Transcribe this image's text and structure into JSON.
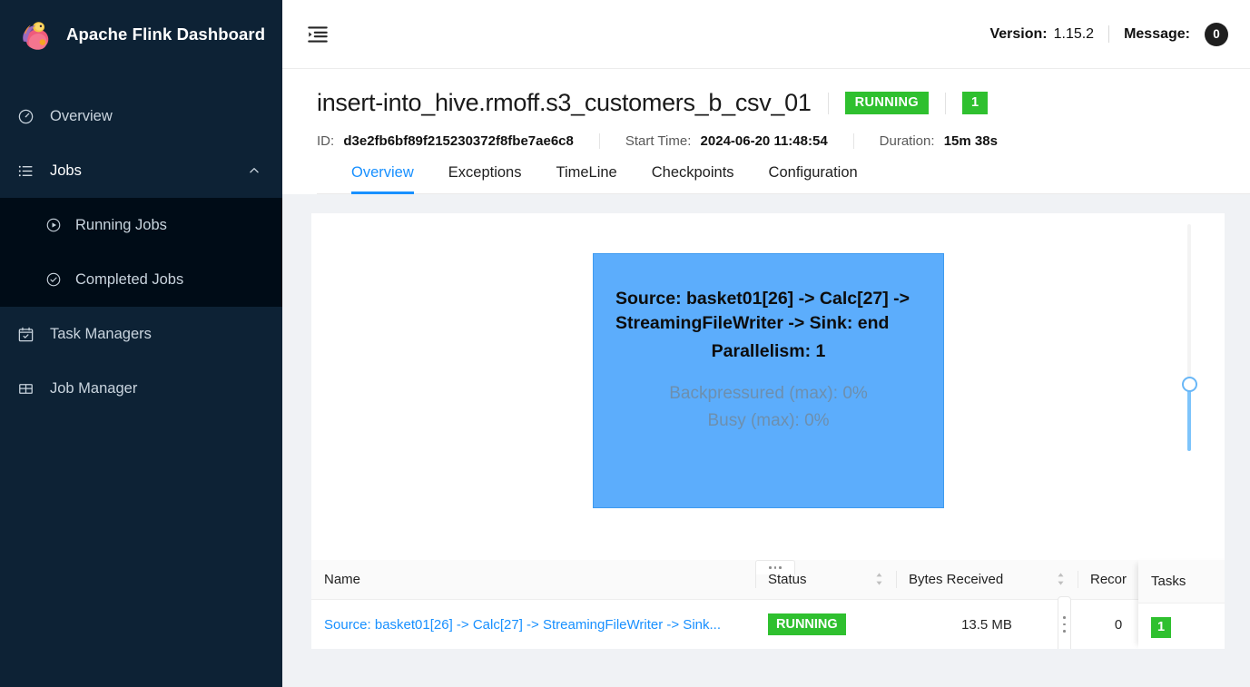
{
  "brand": {
    "title": "Apache Flink Dashboard",
    "logo_icon": "flink-squirrel-logo"
  },
  "sidebar": {
    "items": [
      {
        "label": "Overview",
        "icon": "dashboard-icon"
      },
      {
        "label": "Jobs",
        "icon": "list-icon",
        "expand_icon": "chevron-up-icon"
      },
      {
        "label": "Task Managers",
        "icon": "calendar-check-icon"
      },
      {
        "label": "Job Manager",
        "icon": "grid-icon"
      }
    ],
    "jobs_submenu": [
      {
        "label": "Running Jobs",
        "icon": "play-circle-icon"
      },
      {
        "label": "Completed Jobs",
        "icon": "check-circle-icon"
      }
    ]
  },
  "topbar": {
    "fold_icon": "menu-fold-icon",
    "version_label": "Version:",
    "version_value": "1.15.2",
    "message_label": "Message:",
    "message_count": "0"
  },
  "job": {
    "name": "insert-into_hive.rmoff.s3_customers_b_csv_01",
    "status": "RUNNING",
    "task_count": "1",
    "id_label": "ID:",
    "id_value": "d3e2fb6bf89f215230372f8fbe7ae6c8",
    "start_label": "Start Time:",
    "start_value": "2024-06-20 11:48:54",
    "duration_label": "Duration:",
    "duration_value": "15m 38s"
  },
  "tabs": [
    {
      "label": "Overview",
      "active": true
    },
    {
      "label": "Exceptions",
      "active": false
    },
    {
      "label": "TimeLine",
      "active": false
    },
    {
      "label": "Checkpoints",
      "active": false
    },
    {
      "label": "Configuration",
      "active": false
    }
  ],
  "graph": {
    "node_name": "Source: basket01[26] -> Calc[27] -> StreamingFileWriter -> Sink: end",
    "parallelism": "Parallelism: 1",
    "backpressured": "Backpressured (max): 0%",
    "busy": "Busy (max): 0%",
    "zoom_slider_icon": "zoom-slider"
  },
  "table": {
    "columns": [
      "Name",
      "Status",
      "Bytes Received",
      "Recor",
      "Tasks"
    ],
    "rows": [
      {
        "name": "Source: basket01[26] -> Calc[27] -> StreamingFileWriter -> Sink...",
        "status": "RUNNING",
        "bytes_received": "13.5 MB",
        "records": "0",
        "tasks": "1"
      }
    ]
  },
  "colors": {
    "accent_blue": "#1890ff",
    "status_green": "#2FC02F",
    "node_blue": "#5CADFC",
    "sidebar_bg": "#0d2235",
    "submenu_bg": "#000c17"
  }
}
